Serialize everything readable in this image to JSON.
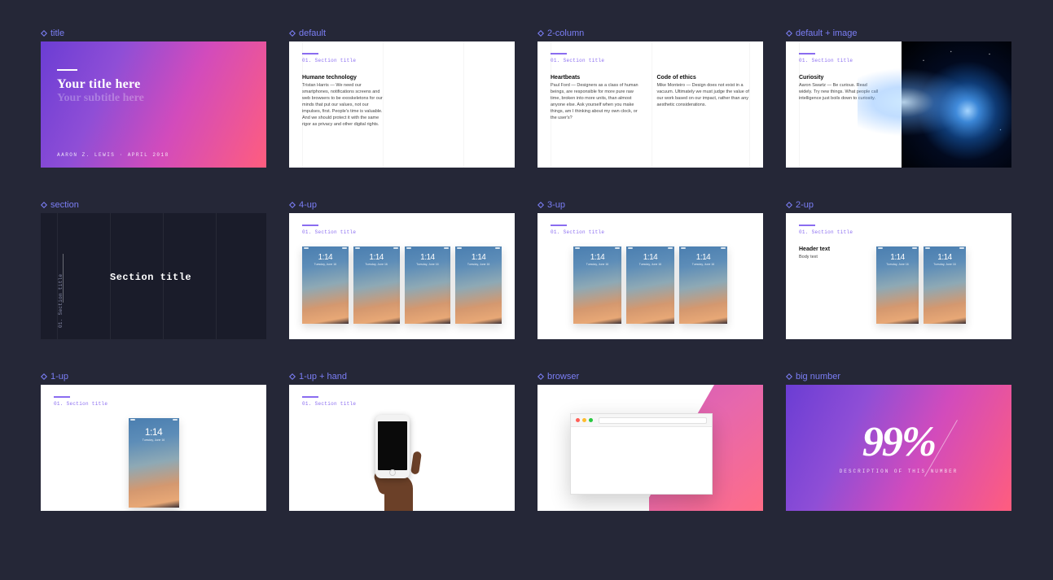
{
  "labels": {
    "title": "title",
    "default": "default",
    "two_column": "2-column",
    "default_image": "default + image",
    "section": "section",
    "four_up": "4-up",
    "three_up": "3-up",
    "two_up": "2-up",
    "one_up": "1-up",
    "one_up_hand": "1-up + hand",
    "browser": "browser",
    "big_number": "big number"
  },
  "title_slide": {
    "title": "Your title here",
    "subtitle": "Your subtitle here",
    "meta": "AARON Z. LEWIS · APRIL 2018"
  },
  "default_slide": {
    "section": "01. Section title",
    "heading": "Humane technology",
    "body": "Tristan Harris — We need our smartphones, notifications screens and web browsers to be exoskeletons for our minds that put our values, not our impulses, first. People's time is valuable. And we should protect it with the same rigor as privacy and other digital rights."
  },
  "two_col_slide": {
    "section": "01. Section title",
    "col1_h": "Heartbeats",
    "col1_p": "Paul Ford — Designers as a class of human beings, are responsible for more pure raw time, broken into more units, than almost anyone else. Ask yourself when you make things, am I thinking about my own clock, or the user's?",
    "col2_h": "Code of ethics",
    "col2_p": "Mike Monteiro — Design does not exist in a vacuum. Ultimately we must judge the value of our work based on our impact, rather than any aesthetic considerations."
  },
  "default_image_slide": {
    "section": "01. Section title",
    "heading": "Curiosity",
    "body": "Aaron Swartz — Be curious. Read widely. Try new things. What people call intelligence just boils down to curiosity."
  },
  "section_slide": {
    "side": "01. Section title",
    "main": "Section title"
  },
  "mockup_section": "01. Section title",
  "two_up_slide": {
    "section": "01. Section title",
    "heading": "Header text",
    "body": "Body text"
  },
  "phone": {
    "time": "1:14",
    "date": "Tuesday, June 16"
  },
  "big_number": {
    "value": "99%",
    "desc": "DESCRIPTION OF THIS NUMBER"
  }
}
